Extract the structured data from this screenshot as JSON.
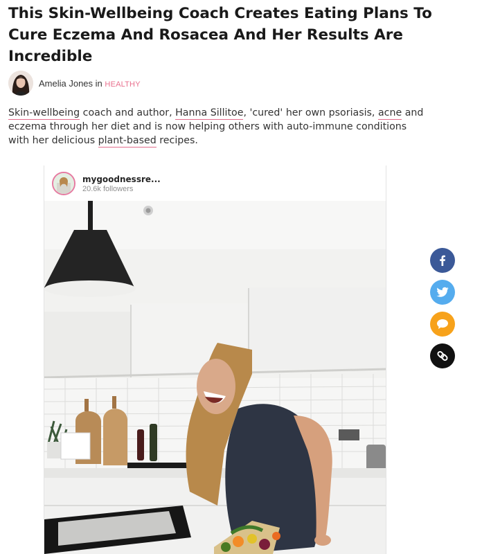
{
  "article": {
    "headline": "This Skin-Wellbeing Coach Creates Eating Plans To Cure Eczema And Rosacea And Her Results Are Incredible",
    "author": "Amelia Jones",
    "in_word": "in",
    "category": "HEALTHY",
    "intro": {
      "link1": "Skin-wellbeing",
      "t1": " coach and author, ",
      "link2": "Hanna Sillitoe",
      "t2": ", 'cured' her own psoriasis, ",
      "link3": "acne",
      "t3": " and eczema through her diet and is now helping others with auto-immune conditions with her delicious ",
      "link4": "plant-based",
      "t4": " recipes."
    }
  },
  "instagram_embed": {
    "username": "mygoodnessre...",
    "followers": "20.6k followers"
  },
  "share": {
    "facebook_icon": "facebook-icon",
    "twitter_icon": "twitter-icon",
    "comment_icon": "comment-icon",
    "link_icon": "link-icon",
    "colors": {
      "facebook": "#3b5998",
      "twitter": "#55acee",
      "comment": "#f7a21b",
      "link": "#111111",
      "accent": "#e9708e"
    }
  }
}
